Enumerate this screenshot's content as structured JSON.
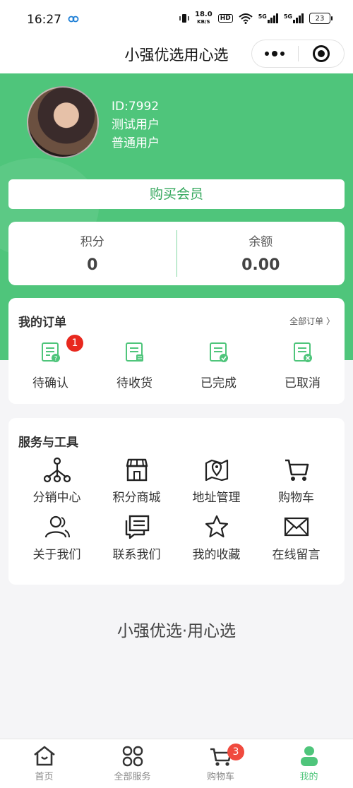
{
  "status_bar": {
    "time": "16:27",
    "net_speed_value": "18.0",
    "net_speed_unit": "KB/S",
    "hd": "HD",
    "signal1": "5G",
    "signal2": "5G",
    "battery": "23"
  },
  "nav": {
    "title": "小强优选用心选"
  },
  "profile": {
    "id": "ID:7992",
    "name": "测试用户",
    "level": "普通用户"
  },
  "buy_vip_label": "购买会员",
  "balance": {
    "points_label": "积分",
    "points_value": "0",
    "money_label": "余额",
    "money_value": "0.00"
  },
  "orders": {
    "title": "我的订单",
    "all_label": "全部订单 〉",
    "items": [
      {
        "label": "待确认",
        "badge": "1",
        "icon": "order-pending-icon"
      },
      {
        "label": "待收货",
        "icon": "order-receive-icon"
      },
      {
        "label": "已完成",
        "icon": "order-done-icon"
      },
      {
        "label": "已取消",
        "icon": "order-cancel-icon"
      }
    ]
  },
  "tools": {
    "title": "服务与工具",
    "items": [
      {
        "label": "分销中心",
        "icon": "distribution-icon"
      },
      {
        "label": "积分商城",
        "icon": "store-icon"
      },
      {
        "label": "地址管理",
        "icon": "map-pin-icon"
      },
      {
        "label": "购物车",
        "icon": "cart-icon"
      },
      {
        "label": "关于我们",
        "icon": "users-icon"
      },
      {
        "label": "联系我们",
        "icon": "chat-icon"
      },
      {
        "label": "我的收藏",
        "icon": "star-icon"
      },
      {
        "label": "在线留言",
        "icon": "mail-icon"
      }
    ]
  },
  "slogan": "小强优选·用心选",
  "tab_bar": {
    "items": [
      {
        "label": "首页",
        "icon": "home-icon"
      },
      {
        "label": "全部服务",
        "icon": "grid-icon"
      },
      {
        "label": "购物车",
        "icon": "cart-icon",
        "badge": "3"
      },
      {
        "label": "我的",
        "icon": "profile-icon",
        "active": true
      }
    ]
  },
  "colors": {
    "brand_green": "#4fc57b",
    "badge_red": "#e8281e"
  }
}
